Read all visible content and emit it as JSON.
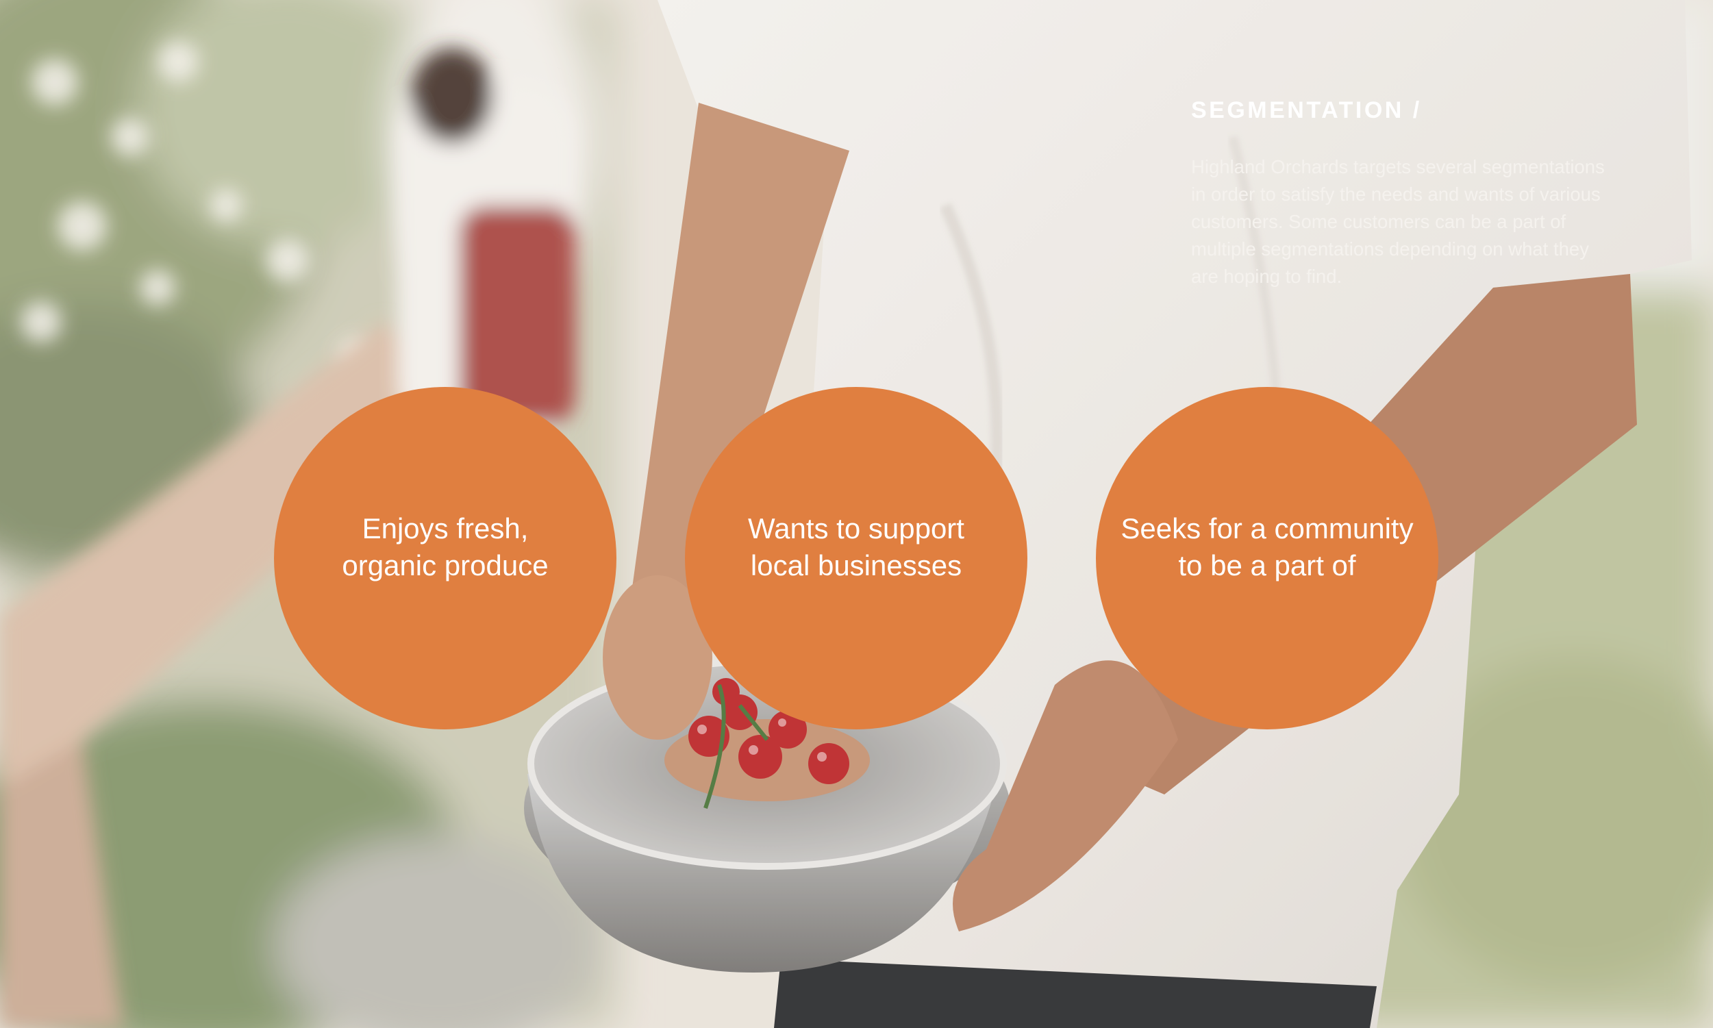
{
  "segmentation": {
    "heading": "SEGMENTATION /",
    "description": "Highland Orchards targets several segmentations in order to satisfy the needs and wants of various customers. Some customers can be a part of multiple segmentations depending on what they are hoping to find."
  },
  "segments": [
    {
      "label": "Enjoys fresh,\norganic produce"
    },
    {
      "label": "Wants to support\nlocal businesses"
    },
    {
      "label": "Seeks for a community\nto be a part of"
    }
  ],
  "colors": {
    "accent": "#e07f40",
    "text_light": "#ffffff"
  }
}
